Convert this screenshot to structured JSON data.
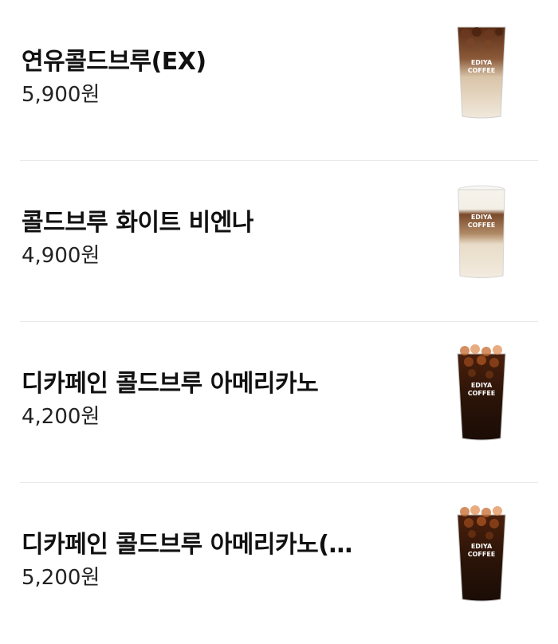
{
  "menu": {
    "items": [
      {
        "name": "연유콜드브루(EX)",
        "price": "5,900원",
        "cup_brand_line1": "EDIYA",
        "cup_brand_line2": "COFFEE",
        "drink": "latte-ice"
      },
      {
        "name": "콜드브루 화이트 비엔나",
        "price": "4,900원",
        "cup_brand_line1": "EDIYA",
        "cup_brand_line2": "COFFEE",
        "drink": "vienna"
      },
      {
        "name": "디카페인 콜드브루 아메리카노",
        "price": "4,200원",
        "cup_brand_line1": "EDIYA",
        "cup_brand_line2": "COFFEE",
        "drink": "americano-ice"
      },
      {
        "name": "디카페인 콜드브루 아메리카노(…",
        "price": "5,200원",
        "cup_brand_line1": "EDIYA",
        "cup_brand_line2": "COFFEE",
        "drink": "americano-ice"
      }
    ]
  },
  "colors": {
    "divider": "#e8e8e8",
    "text": "#111111",
    "coffee_dark": "#2b1408",
    "milk": "#efe6d6",
    "foam": "#f6f3ec"
  }
}
